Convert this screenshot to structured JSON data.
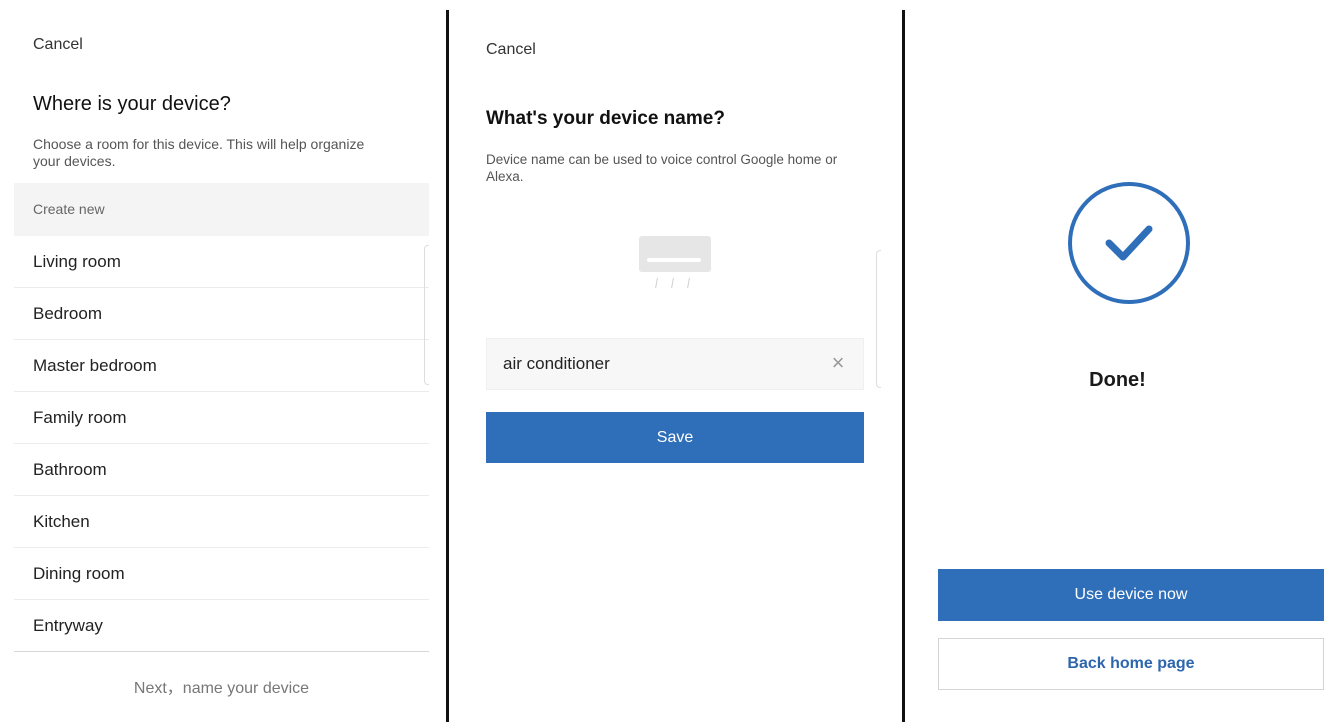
{
  "room_screen": {
    "cancel_label": "Cancel",
    "title": "Where is your device?",
    "description": "Choose a room for this device. This will help organize your devices.",
    "create_new_label": "Create new",
    "rooms": [
      "Living room",
      "Bedroom",
      "Master bedroom",
      "Family room",
      "Bathroom",
      "Kitchen",
      "Dining room",
      "Entryway"
    ],
    "next_label": "Next，name your device"
  },
  "name_screen": {
    "cancel_label": "Cancel",
    "title": "What's your device name?",
    "description": "Device name can be used to voice control Google home or Alexa.",
    "device_icon": "air-conditioner-icon",
    "name_value": "air conditioner",
    "clear_icon": "close-icon",
    "save_label": "Save"
  },
  "done_screen": {
    "status_icon": "checkmark-circle-icon",
    "done_label": "Done!",
    "use_device_label": "Use device now",
    "back_home_label": "Back home page"
  },
  "colors": {
    "accent": "#2f6fba",
    "divider": "#111111"
  }
}
